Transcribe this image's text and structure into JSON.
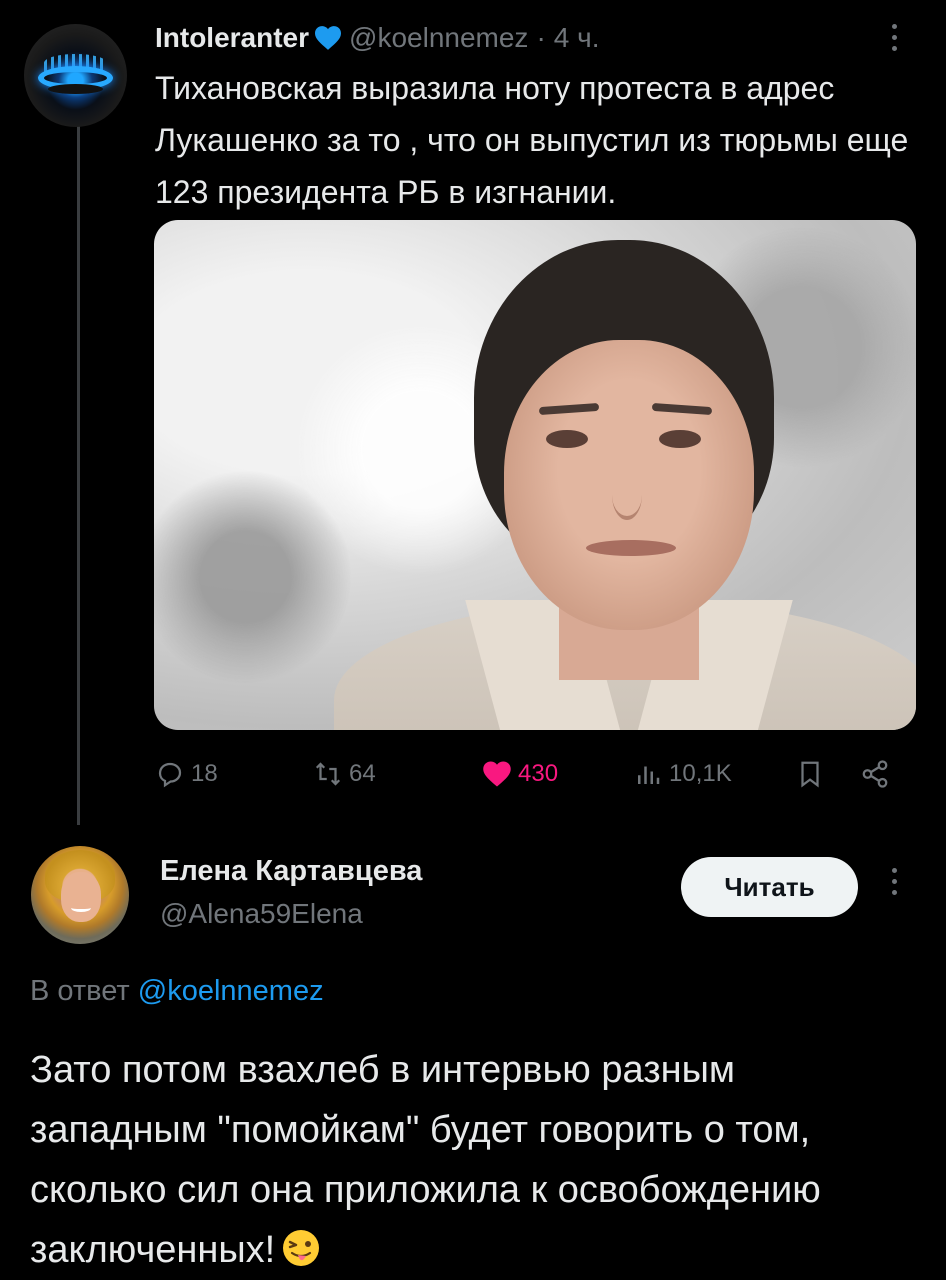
{
  "tweet": {
    "author_name": "Intoleranter",
    "handle": "@koelnnemez",
    "separator": "·",
    "time": "4 ч.",
    "text": "Тихановская выразила ноту протеста в адрес Лукашенко за то , что он выпустил из тюрьмы еще 123 президента РБ в изгнании.",
    "stats": {
      "replies": "18",
      "retweets": "64",
      "likes": "430",
      "views": "10,1K"
    }
  },
  "reply": {
    "author_name": "Елена Картавцева",
    "handle": "@Alena59Elena",
    "follow_label": "Читать",
    "reply_prefix": "В ответ",
    "reply_mention": "@koelnnemez",
    "text": "Зато потом взахлеб в интервью разным западным \"помойкам\" будет говорить о том, сколько сил она приложила к освобождению заключенных!"
  },
  "colors": {
    "background": "#000000",
    "text": "#e7e9ea",
    "muted": "#71767b",
    "link": "#1d9bf0",
    "like": "#f91880",
    "badge_heart": "#1d9bf0"
  },
  "icons": [
    "reply-icon",
    "retweet-icon",
    "like-heart-icon",
    "views-icon",
    "bookmark-icon",
    "share-icon",
    "more-options-icon",
    "blue-heart-badge-icon",
    "squinting-tongue-emoji"
  ]
}
